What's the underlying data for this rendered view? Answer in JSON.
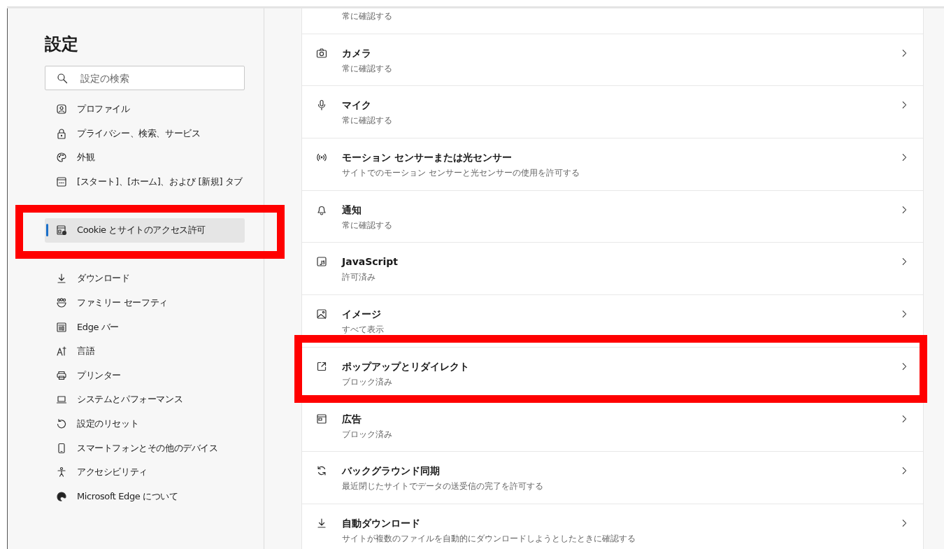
{
  "sidebar": {
    "title": "設定",
    "search": {
      "placeholder": "設定の検索"
    },
    "items": [
      {
        "label": "プロファイル",
        "selected": false,
        "highlighted": false
      },
      {
        "label": "プライバシー、検索、サービス",
        "selected": false,
        "highlighted": false
      },
      {
        "label": "外観",
        "selected": false,
        "highlighted": false
      },
      {
        "label": "[スタート]、[ホーム]、および [新規] タブ",
        "selected": false,
        "highlighted": false
      },
      {
        "label": "Cookie とサイトのアクセス許可",
        "selected": true,
        "highlighted": true
      },
      {
        "label": "ダウンロード",
        "selected": false,
        "highlighted": false
      },
      {
        "label": "ファミリー セーフティ",
        "selected": false,
        "highlighted": false
      },
      {
        "label": "Edge バー",
        "selected": false,
        "highlighted": false
      },
      {
        "label": "言語",
        "selected": false,
        "highlighted": false
      },
      {
        "label": "プリンター",
        "selected": false,
        "highlighted": false
      },
      {
        "label": "システムとパフォーマンス",
        "selected": false,
        "highlighted": false
      },
      {
        "label": "設定のリセット",
        "selected": false,
        "highlighted": false
      },
      {
        "label": "スマートフォンとその他のデバイス",
        "selected": false,
        "highlighted": false
      },
      {
        "label": "アクセシビリティ",
        "selected": false,
        "highlighted": false
      },
      {
        "label": "Microsoft Edge について",
        "selected": false,
        "highlighted": false
      }
    ]
  },
  "permissions": [
    {
      "subtitle": "常に確認する",
      "highlighted": false
    },
    {
      "title": "カメラ",
      "subtitle": "常に確認する",
      "highlighted": false
    },
    {
      "title": "マイク",
      "subtitle": "常に確認する",
      "highlighted": false
    },
    {
      "title": "モーション センサーまたは光センサー",
      "subtitle": "サイトでのモーション センサーと光センサーの使用を許可する",
      "highlighted": false
    },
    {
      "title": "通知",
      "subtitle": "常に確認する",
      "highlighted": false
    },
    {
      "title": "JavaScript",
      "subtitle": "許可済み",
      "highlighted": false
    },
    {
      "title": "イメージ",
      "subtitle": "すべて表示",
      "highlighted": false
    },
    {
      "title": "ポップアップとリダイレクト",
      "subtitle": "ブロック済み",
      "highlighted": true
    },
    {
      "title": "広告",
      "subtitle": "ブロック済み",
      "highlighted": false
    },
    {
      "title": "バックグラウンド同期",
      "subtitle": "最近閉じたサイトでデータの送受信の完了を許可する",
      "highlighted": false
    },
    {
      "title": "自動ダウンロード",
      "subtitle": "サイトが複数のファイルを自動的にダウンロードしようとしたときに確認する",
      "highlighted": false
    }
  ]
}
